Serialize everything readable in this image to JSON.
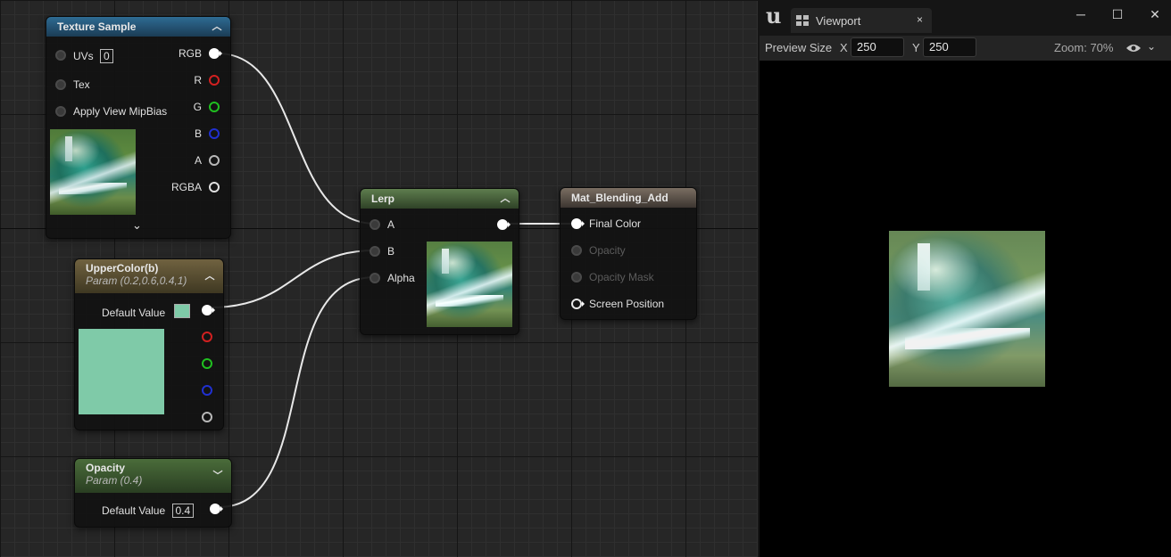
{
  "nodes": {
    "texture_sample": {
      "title": "Texture Sample",
      "inputs": [
        {
          "label": "UVs",
          "value": "0"
        },
        {
          "label": "Tex"
        },
        {
          "label": "Apply View MipBias"
        }
      ],
      "outputs": [
        "RGB",
        "R",
        "G",
        "B",
        "A",
        "RGBA"
      ],
      "expand_glyph": "⌄"
    },
    "upper_color": {
      "title": "UpperColor(b)",
      "subtitle": "Param (0.2,0.6,0.4,1)",
      "default_value_label": "Default Value",
      "swatch_color": "#7fcaa8"
    },
    "opacity": {
      "title": "Opacity",
      "subtitle": "Param (0.4)",
      "default_value_label": "Default Value",
      "default_value": "0.4"
    },
    "lerp": {
      "title": "Lerp",
      "inputs": [
        "A",
        "B",
        "Alpha"
      ]
    },
    "material": {
      "title": "Mat_Blending_Add",
      "inputs": [
        {
          "label": "Final Color",
          "enabled": true
        },
        {
          "label": "Opacity",
          "enabled": false
        },
        {
          "label": "Opacity Mask",
          "enabled": false
        },
        {
          "label": "Screen Position",
          "enabled": true
        }
      ]
    }
  },
  "viewport": {
    "tab_label": "Viewport",
    "tab_close": "×",
    "window_buttons": {
      "minimize": "─",
      "maximize": "☐",
      "close": "✕"
    },
    "preview_size_label": "Preview Size",
    "x_label": "X",
    "x_value": "250",
    "y_label": "Y",
    "y_value": "250",
    "zoom_text": "Zoom: 70%"
  },
  "pin_colors": {
    "R": "#d22020",
    "G": "#20c020",
    "B": "#2030d0",
    "A": "#b8b8b8",
    "RGB": "#ffffff"
  }
}
